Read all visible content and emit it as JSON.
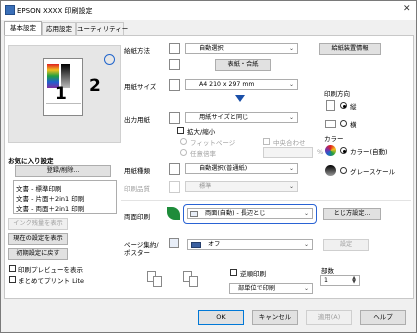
{
  "window": {
    "title": "EPSON XXXX 印刷設定",
    "close_glyph": "✕"
  },
  "tabs": [
    {
      "label": "基本設定"
    },
    {
      "label": "応用設定"
    },
    {
      "label": "ユーティリティー"
    }
  ],
  "preview": {
    "page_number_1": "1",
    "page_number_2": "2"
  },
  "favorites": {
    "label": "お気に入り設定",
    "register_button": "登録/削除...",
    "items": [
      "文書 - 標準印刷",
      "文書 - 片面＋2in1 印刷",
      "文書 - 両面＋2in1 印刷"
    ]
  },
  "left_buttons": {
    "ink_level": "インク残量を表示",
    "current_settings": "現在の設定を表示",
    "reset_settings": "初期設定に戻す"
  },
  "left_checks": {
    "print_preview": "印刷プレビューを表示",
    "epson_print_lite": "まとめてプリント Lite"
  },
  "settings": {
    "paper_source_label": "給紙方法",
    "paper_source_value": "自動選択",
    "paper_source_info_button": "給紙装置情報",
    "envelope_button": "表紙・合紙",
    "paper_size_label": "用紙サイズ",
    "paper_size_value": "A4 210 x 297 mm",
    "output_paper_label": "出力用紙",
    "output_paper_value": "用紙サイズと同じ",
    "scale_checkbox": "拡大/縮小",
    "fit_page": "フィットページ",
    "center": "中央合わせ",
    "any_scale": "任意倍率",
    "scale_unit": "%",
    "paper_type_label": "用紙種類",
    "paper_type_value": "自動選択(普通紙)",
    "quality_label": "印刷品質",
    "quality_value": "標準",
    "duplex_label": "両面印刷",
    "duplex_value": "両面(自動) - 長辺とじ",
    "binding_button": "とじ方設定...",
    "layout_label_1": "ページ集約/",
    "layout_label_2": "ポスター",
    "layout_value": "オフ",
    "layout_settings_button": "設定",
    "reverse_order": "逆順印刷",
    "copies_label": "部数",
    "copies_value": "1",
    "collate_value": "部単位で印刷"
  },
  "orientation": {
    "label": "印刷方向",
    "portrait": "縦",
    "landscape": "横"
  },
  "color": {
    "label": "カラー",
    "auto": "カラー(自動)",
    "grayscale": "グレースケール"
  },
  "footer": {
    "ok": "OK",
    "cancel": "キャンセル",
    "apply": "適用(A)",
    "help": "ヘルプ"
  }
}
